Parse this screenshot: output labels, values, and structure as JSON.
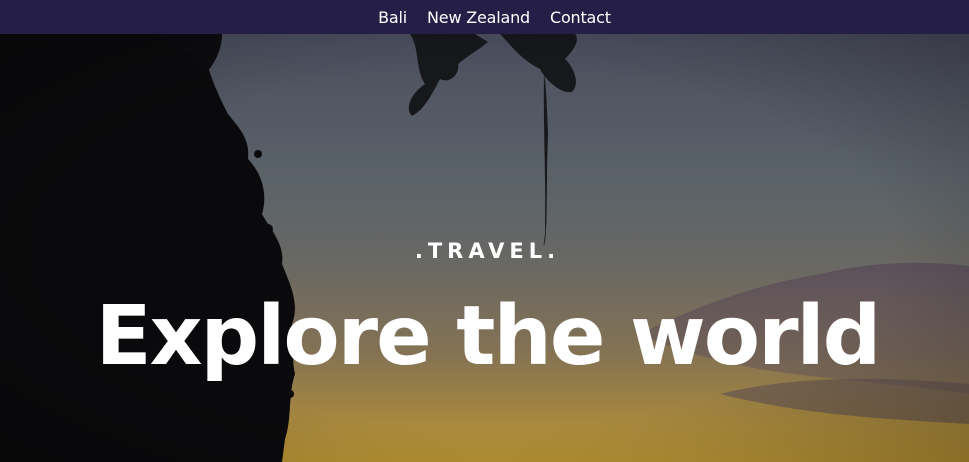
{
  "nav": {
    "items": [
      {
        "label": "Bali"
      },
      {
        "label": "New Zealand"
      },
      {
        "label": "Contact"
      }
    ],
    "background_color": "#251e46"
  },
  "hero": {
    "kicker": ".TRAVEL.",
    "headline": "Explore the world",
    "background": "sunset sky with silhouetted tree"
  }
}
